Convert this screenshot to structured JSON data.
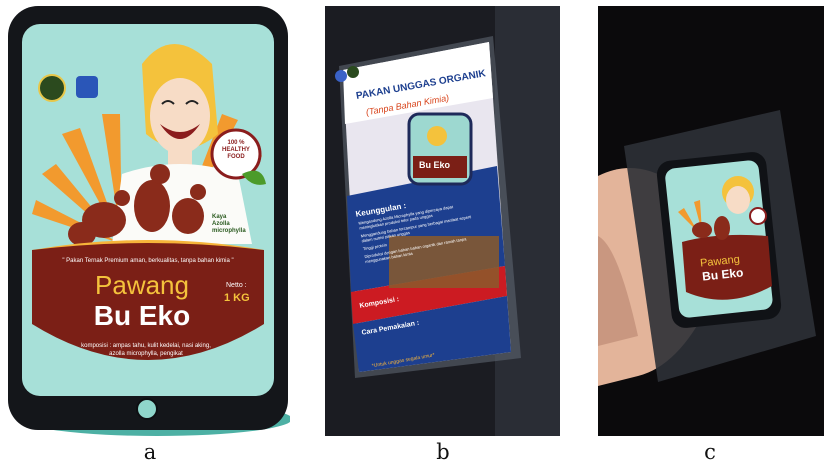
{
  "captions": {
    "a": "a",
    "b": "b",
    "c": "c"
  },
  "package_a": {
    "badge_line1": "100 %",
    "badge_line2": "HEALTHY",
    "badge_line3": "FOOD",
    "feature_line1": "Kaya",
    "feature_line2": "Azolla",
    "feature_line3": "microphylla",
    "tagline": "\" Pakan Ternak Premium aman, berkualitas, tanpa bahan kimia \"",
    "brand_line1": "Pawang",
    "brand_line2": "Bu Eko",
    "netto_label": "Netto :",
    "netto_value": "1 KG",
    "composition": "komposisi : ampas tahu, kulit kedelai, nasi aking, azolla microphylla, pengikat"
  },
  "poster_b": {
    "title": "PAKAN UNGGAS ORGANIK",
    "subtitle": "(Tanpa Bahan Kimia)",
    "mini_brand": "Bu Eko",
    "section_advantages": "Keunggulan :",
    "advantages": [
      "Mengandung Azolla Microphylla yang dipercaya dapat meningkatkan produksi telur pada unggas",
      "Menggandung bahan tercampur yang berbagai manfaat seperti dalam nutrisi pakan unggas",
      "Tinggi protein",
      "Diproduksi dengan bahan bahan organik dan ramah tanpa menggunakan bahan kimia"
    ],
    "section_composition": "Komposisi :",
    "section_usage": "Cara Pemakaian :",
    "footer": "*Untuk unggas segala umur*"
  },
  "package_c": {
    "brand_line1": "Pawang",
    "brand_line2": "Bu Eko"
  },
  "colors": {
    "teal": "#a7e0d8",
    "maroon": "#7b1f16",
    "orange": "#f29a2e",
    "gold": "#f6b43a",
    "navy": "#1d3f8f",
    "red": "#cc1b22"
  }
}
